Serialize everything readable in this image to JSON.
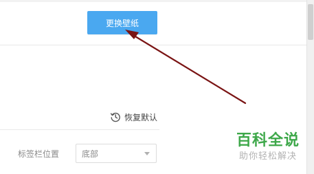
{
  "toolbar": {
    "change_wallpaper_label": "更换壁纸"
  },
  "restore": {
    "label": "恢复默认",
    "icon": "restore-clock-icon"
  },
  "tab_bar_position": {
    "label": "标签栏位置",
    "selected": "底部"
  },
  "annotation": {
    "color": "#7a1414"
  },
  "watermark": {
    "title": "百科全说",
    "subtitle": "助你轻松解决"
  },
  "colors": {
    "button_blue": "#4aa8f0",
    "watermark_green": "#3ea84a"
  }
}
